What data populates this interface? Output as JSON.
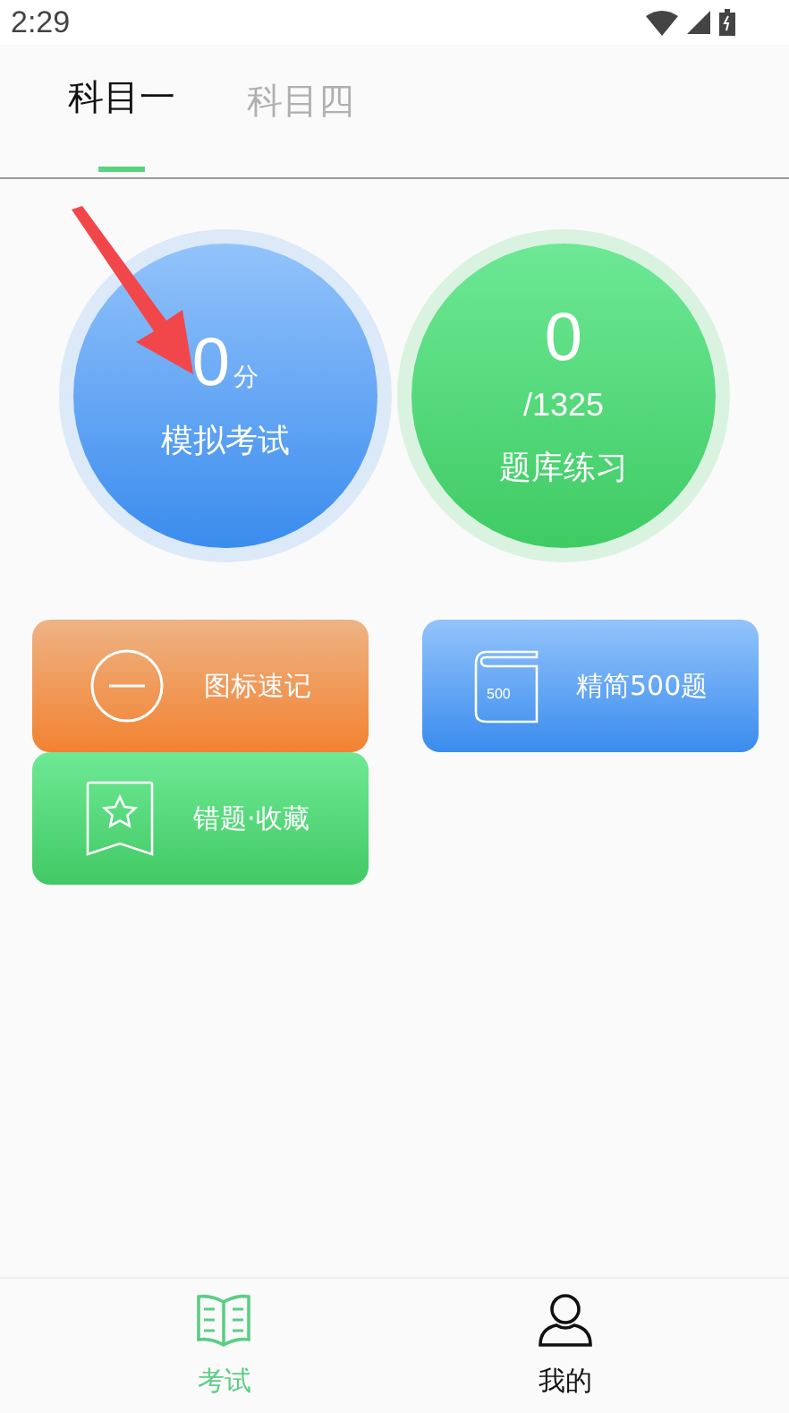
{
  "status_bar": {
    "time": "2:29"
  },
  "tabs": [
    {
      "label": "科目一",
      "selected": true
    },
    {
      "label": "科目四",
      "selected": false
    }
  ],
  "circles": [
    {
      "kind": "exam",
      "value": "0",
      "unit": "分",
      "label": "模拟考试"
    },
    {
      "kind": "practice",
      "value": "0",
      "total": "/1325",
      "label": "题库练习"
    }
  ],
  "tiles": [
    {
      "kind": "signs",
      "label": "图标速记"
    },
    {
      "kind": "book",
      "label": "精简500题",
      "badge": "500"
    },
    {
      "kind": "favorites",
      "label": "错题·收藏"
    }
  ],
  "annotation": {
    "kind": "arrow"
  },
  "bottom_nav": [
    {
      "kind": "exam",
      "label": "考试",
      "selected": true
    },
    {
      "kind": "profile",
      "label": "我的",
      "selected": false
    }
  ]
}
